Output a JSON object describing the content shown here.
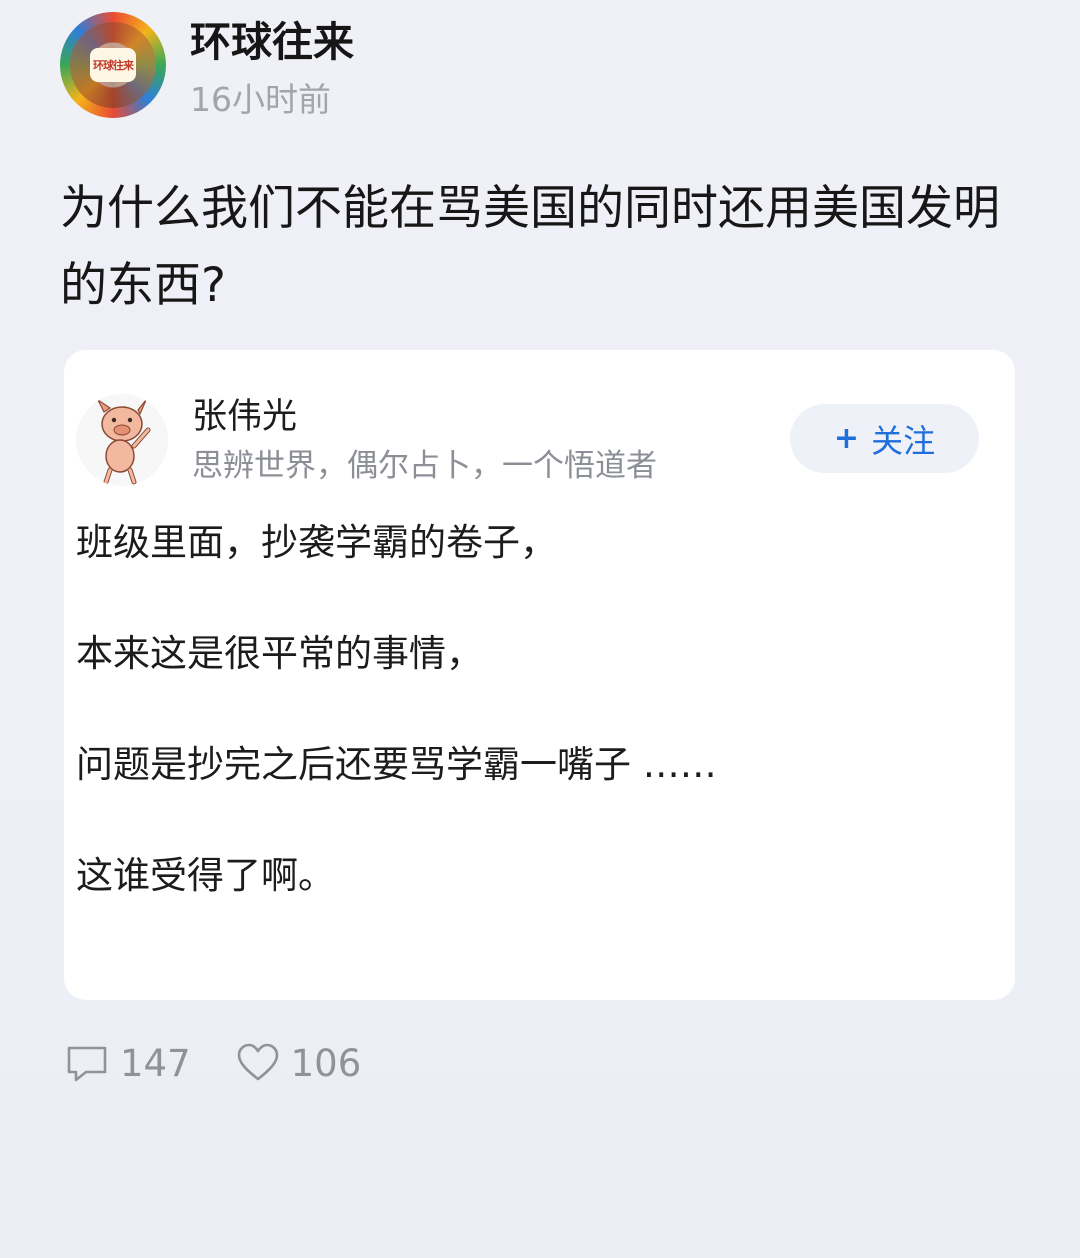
{
  "post": {
    "account_name": "环球往来",
    "avatar_text": "环球往来",
    "time": "16小时前",
    "question": "为什么我们不能在骂美国的同时还用美国发明的东西?"
  },
  "answer": {
    "author_name": "张伟光",
    "author_bio": "思辨世界，偶尔占卜，一个悟道者",
    "follow_label": "关注",
    "follow_icon": "plus-icon",
    "paragraphs": [
      "班级里面，抄袭学霸的卷子，",
      "本来这是很平常的事情，",
      "问题是抄完之后还要骂学霸一嘴子 ……",
      "这谁受得了啊。"
    ]
  },
  "actions": {
    "comment_icon": "comment-icon",
    "comment_count": "147",
    "like_icon": "heart-icon",
    "like_count": "106"
  },
  "colors": {
    "follow_text": "#1e6fd9",
    "meta_text": "#a3a5ab",
    "background": "#eef0f7"
  }
}
